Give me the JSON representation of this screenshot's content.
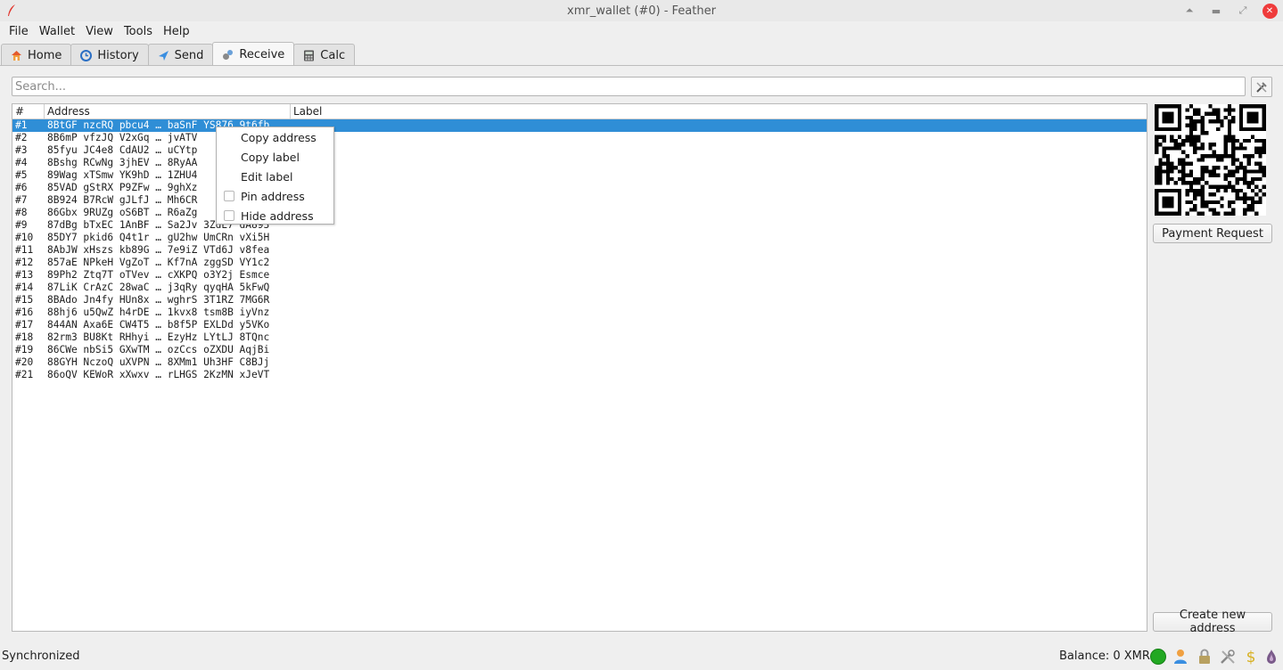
{
  "window": {
    "title": "xmr_wallet (#0) - Feather"
  },
  "menu": [
    "File",
    "Wallet",
    "View",
    "Tools",
    "Help"
  ],
  "tabs": [
    {
      "label": "Home",
      "icon": "home-icon"
    },
    {
      "label": "History",
      "icon": "history-icon"
    },
    {
      "label": "Send",
      "icon": "send-icon"
    },
    {
      "label": "Receive",
      "icon": "receive-icon",
      "active": true
    },
    {
      "label": "Calc",
      "icon": "calc-icon"
    }
  ],
  "search": {
    "placeholder": "Search..."
  },
  "table": {
    "headers": {
      "index": "#",
      "address": "Address",
      "label": "Label"
    },
    "rows": [
      {
        "index": "#1",
        "address": "8BtGF nzcRQ pbcu4 … baSnF YS876 9t6fb",
        "label": ""
      },
      {
        "index": "#2",
        "address": "8B6mP vfzJQ V2xGq … jvATV",
        "label": ""
      },
      {
        "index": "#3",
        "address": "85fyu JC4e8 CdAU2 … uCYtp",
        "label": ""
      },
      {
        "index": "#4",
        "address": "8Bshg RCwNg 3jhEV … 8RyAA",
        "label": ""
      },
      {
        "index": "#5",
        "address": "89Wag xTSmw YK9hD … 1ZHU4",
        "label": ""
      },
      {
        "index": "#6",
        "address": "85VAD gStRX P9ZFw … 9ghXz",
        "label": ""
      },
      {
        "index": "#7",
        "address": "8B924 B7RcW gJLfJ … Mh6CR",
        "label": ""
      },
      {
        "index": "#8",
        "address": "86Gbx 9RUZg oS6BT … R6aZg",
        "label": ""
      },
      {
        "index": "#9",
        "address": "87dBg bTxEC 1AnBF … Sa2Jv 3ZdE7 dA893",
        "label": ""
      },
      {
        "index": "#10",
        "address": "85DY7 pkid6 Q4t1r … gU2hw UmCRn vXi5H",
        "label": ""
      },
      {
        "index": "#11",
        "address": "8AbJW xHszs kb89G … 7e9iZ VTd6J v8fea",
        "label": ""
      },
      {
        "index": "#12",
        "address": "857aE NPkeH VgZoT … Kf7nA zggSD VY1c2",
        "label": ""
      },
      {
        "index": "#13",
        "address": "89Ph2 Ztq7T oTVev … cXKPQ o3Y2j Esmce",
        "label": ""
      },
      {
        "index": "#14",
        "address": "87LiK CrAzC 28waC … j3qRy qyqHA 5kFwQ",
        "label": ""
      },
      {
        "index": "#15",
        "address": "8BAdo Jn4fy HUn8x … wghrS 3T1RZ 7MG6R",
        "label": ""
      },
      {
        "index": "#16",
        "address": "88hj6 u5QwZ h4rDE … 1kvx8 tsm8B iyVnz",
        "label": ""
      },
      {
        "index": "#17",
        "address": "844AN Axa6E CW4T5 … b8f5P EXLDd y5VKo",
        "label": ""
      },
      {
        "index": "#18",
        "address": "82rm3 BU8Kt RHhyi … EzyHz LYtLJ 8TQnc",
        "label": ""
      },
      {
        "index": "#19",
        "address": "86CWe nbSi5 GXwTM … ozCcs oZXDU AqjBi",
        "label": ""
      },
      {
        "index": "#20",
        "address": "88GYH NczoQ uXVPN … 8XMm1 Uh3HF C8BJj",
        "label": ""
      },
      {
        "index": "#21",
        "address": "86oQV KEWoR xXwxv … rLHGS 2KzMN xJeVT",
        "label": ""
      }
    ]
  },
  "context_menu": [
    {
      "label": "Copy address",
      "checkbox": false
    },
    {
      "label": "Copy label",
      "checkbox": false
    },
    {
      "label": "Edit label",
      "checkbox": false
    },
    {
      "label": "Pin address",
      "checkbox": true,
      "checked": false
    },
    {
      "label": "Hide address",
      "checkbox": true,
      "checked": false
    }
  ],
  "buttons": {
    "payment_request": "Payment Request",
    "create_address": "Create new address"
  },
  "status": {
    "sync": "Synchronized",
    "balance": "Balance: 0 XMR"
  },
  "colors": {
    "selection": "#2f8ed6",
    "status_ok": "#22a822",
    "close": "#ef3b3b"
  }
}
